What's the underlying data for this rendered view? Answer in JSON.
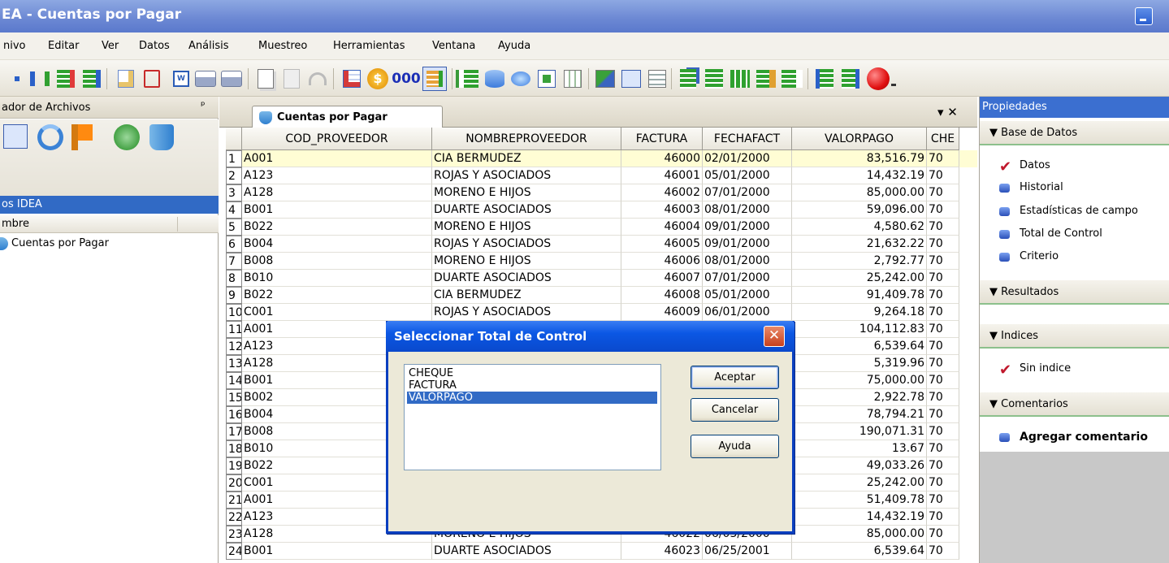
{
  "window": {
    "title": "EA - Cuentas por Pagar"
  },
  "menu": [
    "nivo",
    "Editar",
    "Ver",
    "Datos",
    "Análisis",
    "Muestreo",
    "Herramientas",
    "Ventana",
    "Ayuda"
  ],
  "left_panel": {
    "header": "ador de Archivos",
    "pin": "ᵖ",
    "section": "os IDEA",
    "column_header": "mbre",
    "file": "Cuentas por Pagar"
  },
  "tab": {
    "label": "Cuentas por Pagar",
    "controls": "▾ ✕"
  },
  "grid": {
    "columns": [
      "",
      "COD_PROVEEDOR",
      "NOMBREPROVEEDOR",
      "FACTURA",
      "FECHAFACT",
      "VALORPAGO",
      "CHE"
    ],
    "rows": [
      [
        "1",
        "A001",
        "CIA BERMUDEZ",
        "46000",
        "02/01/2000",
        "83,516.79",
        "70"
      ],
      [
        "2",
        "A123",
        "ROJAS Y ASOCIADOS",
        "46001",
        "05/01/2000",
        "14,432.19",
        "70"
      ],
      [
        "3",
        "A128",
        "MORENO E HIJOS",
        "46002",
        "07/01/2000",
        "85,000.00",
        "70"
      ],
      [
        "4",
        "B001",
        "DUARTE ASOCIADOS",
        "46003",
        "08/01/2000",
        "59,096.00",
        "70"
      ],
      [
        "5",
        "B022",
        "MORENO E HIJOS",
        "46004",
        "09/01/2000",
        "4,580.62",
        "70"
      ],
      [
        "6",
        "B004",
        "ROJAS Y ASOCIADOS",
        "46005",
        "09/01/2000",
        "21,632.22",
        "70"
      ],
      [
        "7",
        "B008",
        "MORENO E HIJOS",
        "46006",
        "08/01/2000",
        "2,792.77",
        "70"
      ],
      [
        "8",
        "B010",
        "DUARTE ASOCIADOS",
        "46007",
        "07/01/2000",
        "25,242.00",
        "70"
      ],
      [
        "9",
        "B022",
        "CIA BERMUDEZ",
        "46008",
        "05/01/2000",
        "91,409.78",
        "70"
      ],
      [
        "10",
        "C001",
        "ROJAS Y ASOCIADOS",
        "46009",
        "06/01/2000",
        "9,264.18",
        "70"
      ],
      [
        "11",
        "A001",
        "",
        "",
        "",
        "104,112.83",
        "70"
      ],
      [
        "12",
        "A123",
        "",
        "",
        "",
        "6,539.64",
        "70"
      ],
      [
        "13",
        "A128",
        "",
        "",
        "",
        "5,319.96",
        "70"
      ],
      [
        "14",
        "B001",
        "",
        "",
        "",
        "75,000.00",
        "70"
      ],
      [
        "15",
        "B002",
        "",
        "",
        "",
        "2,922.78",
        "70"
      ],
      [
        "16",
        "B004",
        "",
        "",
        "",
        "78,794.21",
        "70"
      ],
      [
        "17",
        "B008",
        "",
        "",
        "",
        "190,071.31",
        "70"
      ],
      [
        "18",
        "B010",
        "",
        "",
        "",
        "13.67",
        "70"
      ],
      [
        "19",
        "B022",
        "",
        "",
        "",
        "49,033.26",
        "70"
      ],
      [
        "20",
        "C001",
        "",
        "",
        "",
        "25,242.00",
        "70"
      ],
      [
        "21",
        "A001",
        "",
        "",
        "",
        "51,409.78",
        "70"
      ],
      [
        "22",
        "A123",
        "",
        "",
        "",
        "14,432.19",
        "70"
      ],
      [
        "23",
        "A128",
        "MORENO E HIJOS",
        "46022",
        "06/03/2000",
        "85,000.00",
        "70"
      ],
      [
        "24",
        "B001",
        "DUARTE ASOCIADOS",
        "46023",
        "06/25/2001",
        "6,539.64",
        "70"
      ]
    ]
  },
  "right_panel": {
    "header": "Propiedades",
    "sections": {
      "base": "▼ Base de Datos",
      "resultados": "▼ Resultados",
      "indices": "▼ Indices",
      "comentarios": "▼ Comentarios"
    },
    "base_items": [
      "Datos",
      "Historial",
      "Estadísticas de campo",
      "Total de Control",
      "Criterio"
    ],
    "indices_item": "Sin indice",
    "comentarios_item": "Agregar comentario"
  },
  "dialog": {
    "title": "Seleccionar Total de Control",
    "close": "✕",
    "options": [
      "CHEQUE",
      "FACTURA",
      "VALORPAGO"
    ],
    "selected": "VALORPAGO",
    "buttons": {
      "accept": "Aceptar",
      "cancel": "Cancelar",
      "help": "Ayuda"
    }
  },
  "toolbar": {
    "text_button": "000"
  }
}
